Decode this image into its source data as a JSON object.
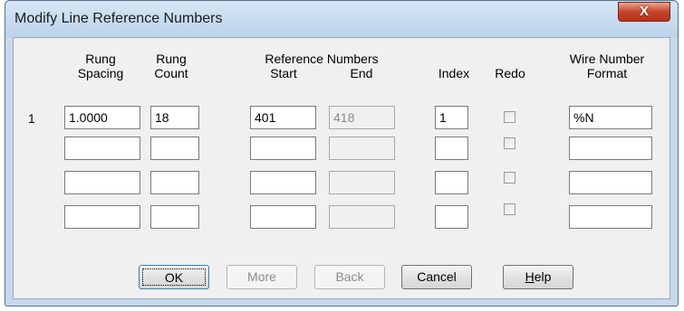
{
  "dialog": {
    "title": "Modify Line Reference Numbers",
    "close_label": "X"
  },
  "headers": {
    "rung_spacing": [
      "Rung",
      "Spacing"
    ],
    "rung_count": [
      "Rung",
      "Count"
    ],
    "reference_numbers": "Reference Numbers",
    "start": "Start",
    "end": "End",
    "index": "Index",
    "redo": "Redo",
    "wire_number_format": [
      "Wire Number",
      "Format"
    ]
  },
  "rows": [
    {
      "num": "1",
      "spacing": "1.0000",
      "count": "18",
      "start": "401",
      "end": "418",
      "index": "1",
      "redo": false,
      "format": "%N"
    },
    {
      "num": "",
      "spacing": "",
      "count": "",
      "start": "",
      "end": "",
      "index": "",
      "redo": false,
      "format": ""
    },
    {
      "num": "",
      "spacing": "",
      "count": "",
      "start": "",
      "end": "",
      "index": "",
      "redo": false,
      "format": ""
    },
    {
      "num": "",
      "spacing": "",
      "count": "",
      "start": "",
      "end": "",
      "index": "",
      "redo": false,
      "format": ""
    }
  ],
  "buttons": {
    "ok": "OK",
    "more": "More",
    "back": "Back",
    "cancel": "Cancel",
    "help_prefix": "",
    "help_mnemonic": "H",
    "help_rest": "elp"
  }
}
